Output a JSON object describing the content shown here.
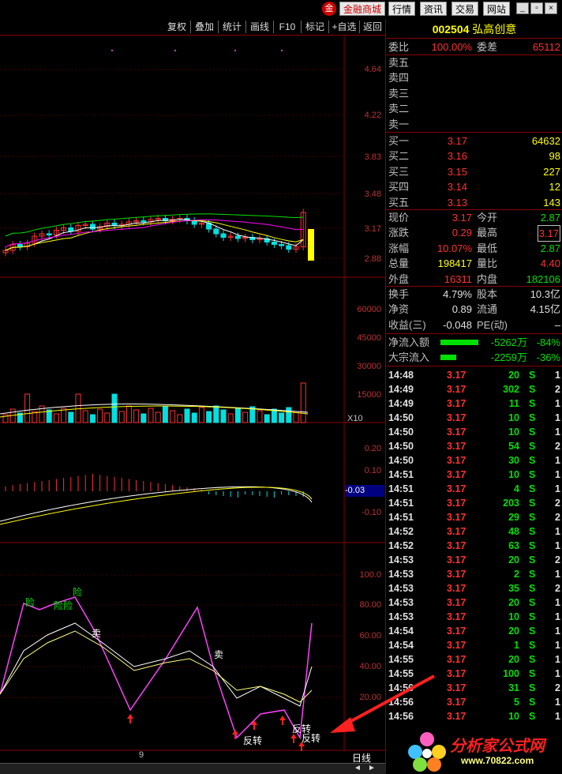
{
  "topbar": {
    "shop": "金融商城",
    "tabs": [
      "行情",
      "资讯",
      "交易",
      "网站"
    ]
  },
  "toolbar": [
    "复权",
    "叠加",
    "统计",
    "画线",
    "F10",
    "标记",
    "+自选",
    "返回"
  ],
  "main_chart": {
    "price_ticks": [
      "4.64",
      "4.22",
      "3.83",
      "3.48",
      "3.17",
      "2.88"
    ],
    "volume_ticks": [
      "60000",
      "45000",
      "30000",
      "15000"
    ],
    "volume_unit": "X10",
    "macd_ticks": [
      "0.20",
      "0.10",
      "-0.10"
    ],
    "macd_current": "-0.03",
    "osc_ticks": [
      "100.0",
      "80.00",
      "60.00",
      "40.00",
      "20.00"
    ],
    "osc_labels": [
      "险",
      "险险",
      "险",
      "卖",
      "卖",
      "反转",
      "反转",
      "反转"
    ],
    "date_label": "9",
    "period": "日线"
  },
  "chart_data": {
    "type": "candlestick",
    "price_range": [
      2.8,
      4.8
    ],
    "last_close": 3.17,
    "volume_range": [
      0,
      70000
    ],
    "macd_range": [
      -0.15,
      0.3
    ],
    "osc_range": [
      0,
      120
    ]
  },
  "stock": {
    "code": "002504",
    "name": "弘高创意"
  },
  "orderbook": {
    "wei_bi_label": "委比",
    "wei_bi": "100.00%",
    "wei_cha_label": "委差",
    "wei_cha": "65112",
    "sells": [
      "卖五",
      "卖四",
      "卖三",
      "卖二",
      "卖一"
    ],
    "buys": [
      {
        "label": "买一",
        "price": "3.17",
        "vol": "64632"
      },
      {
        "label": "买二",
        "price": "3.16",
        "vol": "98"
      },
      {
        "label": "买三",
        "price": "3.15",
        "vol": "227"
      },
      {
        "label": "买四",
        "price": "3.14",
        "vol": "12"
      },
      {
        "label": "买五",
        "price": "3.13",
        "vol": "143"
      }
    ]
  },
  "quote": [
    {
      "l1": "现价",
      "v1": "3.17",
      "l2": "今开",
      "v2": "2.87",
      "c1": "red",
      "c2": "green"
    },
    {
      "l1": "涨跌",
      "v1": "0.29",
      "l2": "最高",
      "v2": "3.17",
      "c1": "red",
      "c2": "red"
    },
    {
      "l1": "涨幅",
      "v1": "10.07%",
      "l2": "最低",
      "v2": "2.87",
      "c1": "red",
      "c2": "green"
    },
    {
      "l1": "总量",
      "v1": "198417",
      "l2": "量比",
      "v2": "4.40",
      "c1": "yellow",
      "c2": "red"
    },
    {
      "l1": "外盘",
      "v1": "16311",
      "l2": "内盘",
      "v2": "182106",
      "c1": "red",
      "c2": "green"
    }
  ],
  "fundamentals": [
    {
      "l1": "换手",
      "v1": "4.79%",
      "l2": "股本",
      "v2": "10.3亿"
    },
    {
      "l1": "净资",
      "v1": "0.89",
      "l2": "流通",
      "v2": "4.15亿"
    },
    {
      "l1": "收益(三)",
      "v1": "-0.048",
      "l2": "PE(动)",
      "v2": "–"
    }
  ],
  "flows": [
    {
      "label": "净流入额",
      "value": "-5262万",
      "pct": "-84%",
      "bar": 48
    },
    {
      "label": "大宗流入",
      "value": "-2259万",
      "pct": "-36%",
      "bar": 20
    }
  ],
  "trades": [
    {
      "t": "14:48",
      "p": "3.17",
      "v": "20",
      "s": "S",
      "n": "1"
    },
    {
      "t": "14:49",
      "p": "3.17",
      "v": "302",
      "s": "S",
      "n": "2"
    },
    {
      "t": "14:49",
      "p": "3.17",
      "v": "11",
      "s": "S",
      "n": "1"
    },
    {
      "t": "14:50",
      "p": "3.17",
      "v": "10",
      "s": "S",
      "n": "1"
    },
    {
      "t": "14:50",
      "p": "3.17",
      "v": "10",
      "s": "S",
      "n": "1"
    },
    {
      "t": "14:50",
      "p": "3.17",
      "v": "54",
      "s": "S",
      "n": "2"
    },
    {
      "t": "14:50",
      "p": "3.17",
      "v": "30",
      "s": "S",
      "n": "1"
    },
    {
      "t": "14:51",
      "p": "3.17",
      "v": "10",
      "s": "S",
      "n": "1"
    },
    {
      "t": "14:51",
      "p": "3.17",
      "v": "4",
      "s": "S",
      "n": "1"
    },
    {
      "t": "14:51",
      "p": "3.17",
      "v": "203",
      "s": "S",
      "n": "2"
    },
    {
      "t": "14:51",
      "p": "3.17",
      "v": "29",
      "s": "S",
      "n": "2"
    },
    {
      "t": "14:52",
      "p": "3.17",
      "v": "48",
      "s": "S",
      "n": "1"
    },
    {
      "t": "14:52",
      "p": "3.17",
      "v": "63",
      "s": "S",
      "n": "1"
    },
    {
      "t": "14:53",
      "p": "3.17",
      "v": "20",
      "s": "S",
      "n": "2"
    },
    {
      "t": "14:53",
      "p": "3.17",
      "v": "2",
      "s": "S",
      "n": "1"
    },
    {
      "t": "14:53",
      "p": "3.17",
      "v": "35",
      "s": "S",
      "n": "2"
    },
    {
      "t": "14:53",
      "p": "3.17",
      "v": "20",
      "s": "S",
      "n": "1"
    },
    {
      "t": "14:53",
      "p": "3.17",
      "v": "10",
      "s": "S",
      "n": "1"
    },
    {
      "t": "14:54",
      "p": "3.17",
      "v": "20",
      "s": "S",
      "n": "1"
    },
    {
      "t": "14:54",
      "p": "3.17",
      "v": "1",
      "s": "S",
      "n": "1"
    },
    {
      "t": "14:55",
      "p": "3.17",
      "v": "20",
      "s": "S",
      "n": "1"
    },
    {
      "t": "14:55",
      "p": "3.17",
      "v": "100",
      "s": "S",
      "n": "1"
    },
    {
      "t": "14:56",
      "p": "3.17",
      "v": "31",
      "s": "S",
      "n": "2"
    },
    {
      "t": "14:56",
      "p": "3.17",
      "v": "5",
      "s": "S",
      "n": "1"
    },
    {
      "t": "14:56",
      "p": "3.17",
      "v": "10",
      "s": "S",
      "n": "1"
    }
  ],
  "watermark": {
    "text": "分析家公式网",
    "url": "www.70822.com"
  },
  "colors": {
    "up": "#ff3030",
    "down": "#00e0e0",
    "ma5": "#ffffff",
    "ma10": "#ffff00",
    "ma20": "#ff00ff",
    "ma60": "#00e000"
  }
}
